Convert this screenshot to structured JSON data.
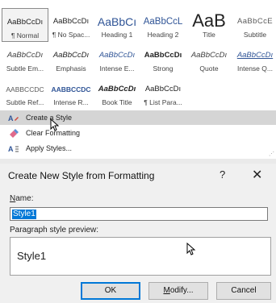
{
  "gallery": {
    "styles": [
      {
        "sample": "AaBbCcDı",
        "caption": "¶ Normal",
        "variant": "normal"
      },
      {
        "sample": "AaBbCcDı",
        "caption": "¶ No Spac...",
        "variant": "nospace"
      },
      {
        "sample": "AaBbCı",
        "caption": "Heading 1",
        "variant": "h1"
      },
      {
        "sample": "AaBbCcL",
        "caption": "Heading 2",
        "variant": "h2"
      },
      {
        "sample": "AaB",
        "caption": "Title",
        "variant": "title"
      },
      {
        "sample": "AaBbCcE",
        "caption": "Subtitle",
        "variant": "subtitle"
      },
      {
        "sample": "AaBbCcDı",
        "caption": "Subtle Em...",
        "variant": "subtleem"
      },
      {
        "sample": "AaBbCcDı",
        "caption": "Emphasis",
        "variant": "emphasis"
      },
      {
        "sample": "AaBbCcDı",
        "caption": "Intense E...",
        "variant": "intenseem"
      },
      {
        "sample": "AaBbCcDı",
        "caption": "Strong",
        "variant": "strong"
      },
      {
        "sample": "AaBbCcDı",
        "caption": "Quote",
        "variant": "quote"
      },
      {
        "sample": "AaBbCcDı",
        "caption": "Intense Q...",
        "variant": "intenseq"
      },
      {
        "sample": "AABBCCDC",
        "caption": "Subtle Ref...",
        "variant": "subtleref"
      },
      {
        "sample": "AABBCCDC",
        "caption": "Intense R...",
        "variant": "intenseref"
      },
      {
        "sample": "AaBbCcDı",
        "caption": "Book Title",
        "variant": "booktitle"
      },
      {
        "sample": "AaBbCcDı",
        "caption": "¶ List Para...",
        "variant": "listpara"
      }
    ]
  },
  "menu": {
    "create_style": "Create a Style",
    "clear_formatting": "Clear Formatting",
    "apply_styles": "Apply Styles..."
  },
  "dialog": {
    "title": "Create New Style from Formatting",
    "help": "?",
    "close": "✕",
    "name_label": "Name:",
    "name_value": "Style1",
    "preview_label": "Paragraph style preview:",
    "preview_text": "Style1",
    "ok": "OK",
    "modify": "Modify...",
    "cancel": "Cancel"
  },
  "colors": {
    "accent": "#0078d7",
    "heading_blue": "#2f5496",
    "highlight_bg": "#d5d5d5"
  }
}
